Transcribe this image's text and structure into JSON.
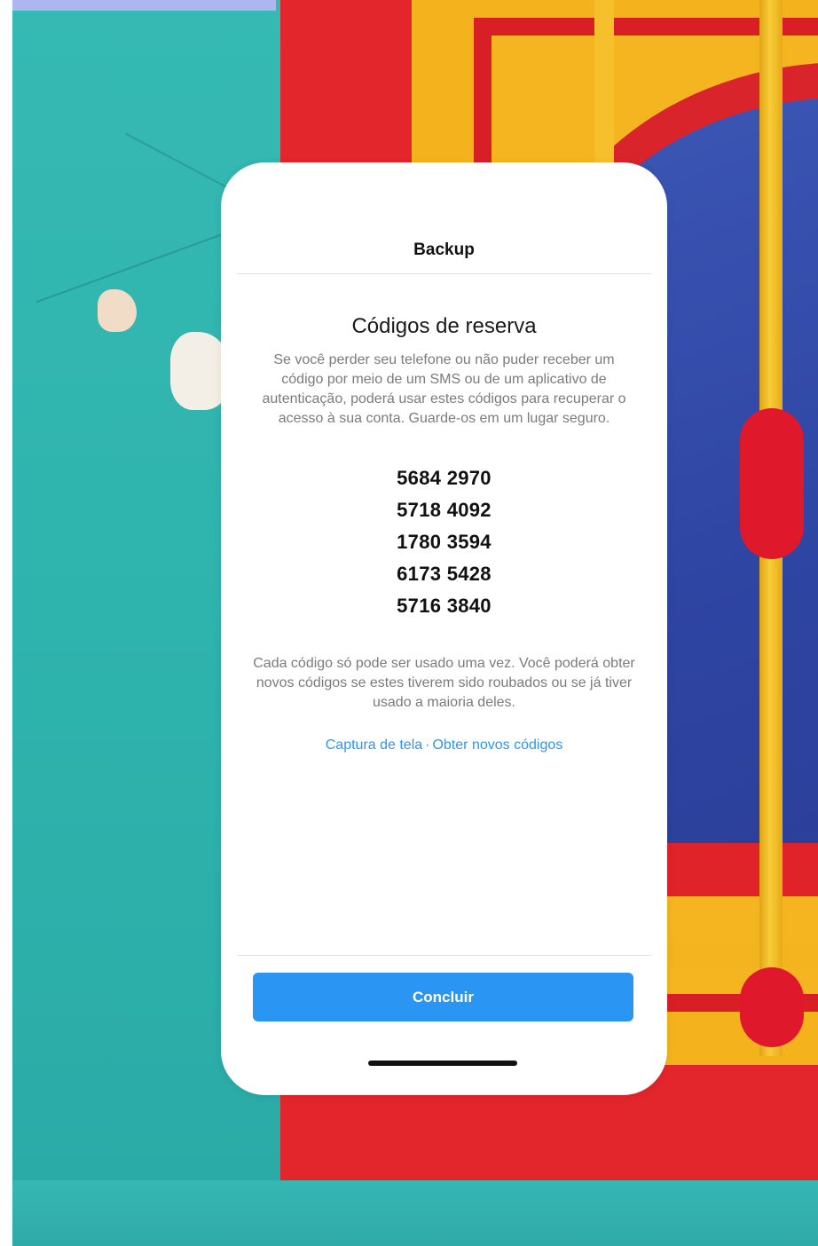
{
  "screen": {
    "title": "Backup",
    "heading": "Códigos de reserva",
    "description": "Se você perder seu telefone ou não puder receber um código por meio de um SMS ou de um aplicativo de autenticação, poderá usar estes códigos para recuperar o acesso à sua conta. Guarde-os em um lugar seguro.",
    "codes": [
      "5684 2970",
      "5718 4092",
      "1780 3594",
      "6173 5428",
      "5716 3840"
    ],
    "note": "Cada código só pode ser usado uma vez. Você poderá obter novos códigos se estes tiverem sido roubados ou se já tiver usado a maioria deles.",
    "links": {
      "screenshot": "Captura de tela",
      "separator": "·",
      "new_codes": "Obter novos códigos"
    },
    "done_button": "Concluir"
  },
  "colors": {
    "accent_blue": "#2a95f3",
    "background_teal": "#37bcb6",
    "frame_red": "#e3262b",
    "frame_yellow": "#f4b31d",
    "door_blue": "#3c57b6"
  }
}
